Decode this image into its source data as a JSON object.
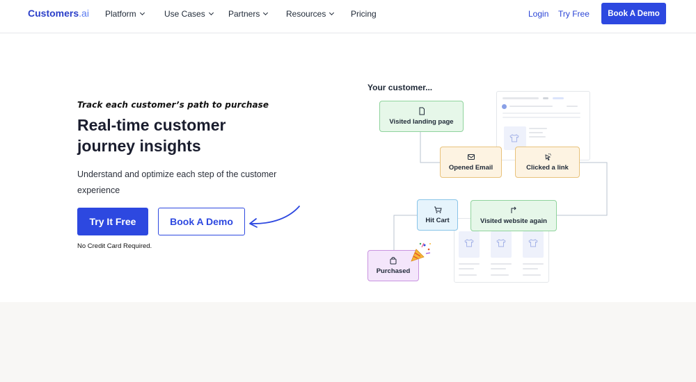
{
  "nav": {
    "logo_main": "Customers",
    "logo_suffix": ".ai",
    "items": [
      "Platform",
      "Use Cases",
      "Partners",
      "Resources"
    ],
    "pricing": "Pricing",
    "login": "Login",
    "try_free": "Try Free",
    "book_demo": "Book A Demo"
  },
  "hero": {
    "eyebrow": "Track each customer’s path to purchase",
    "headline": "Real-time customer journey insights",
    "subtext": "Understand and optimize each step of the customer experience",
    "primary_cta": "Try It Free",
    "secondary_cta": "Book A Demo",
    "note": "No Credit Card Required."
  },
  "illustration": {
    "title": "Your customer...",
    "steps": [
      {
        "label": "Visited landing page",
        "icon": "page-icon",
        "color": "#e6f7e9"
      },
      {
        "label": "Opened Email",
        "icon": "envelope-icon",
        "color": "#fdf3e2"
      },
      {
        "label": "Clicked a link",
        "icon": "cursor-click-icon",
        "color": "#fdf3e2"
      },
      {
        "label": "Hit Cart",
        "icon": "cart-icon",
        "color": "#e6f4fc"
      },
      {
        "label": "Visited website again",
        "icon": "return-arrow-icon",
        "color": "#e6f7e9"
      },
      {
        "label": "Purchased",
        "icon": "bag-icon",
        "color": "#f4e6fb"
      }
    ],
    "celebration_icon": "party-popper-icon"
  },
  "colors": {
    "brand": "#2d48e0",
    "text": "#1a1d2e",
    "footer_band": "#f8f7f5"
  }
}
